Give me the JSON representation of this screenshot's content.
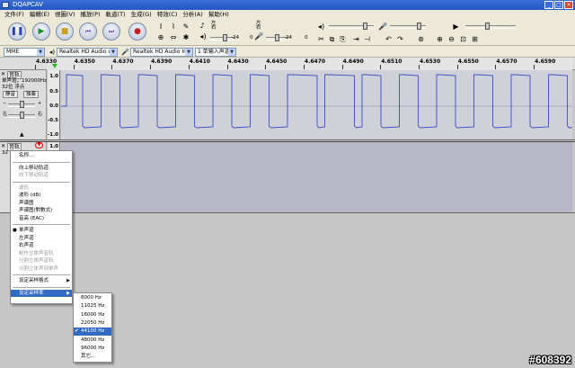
{
  "window": {
    "title": "DQAPCAV"
  },
  "menu": [
    "文件(F)",
    "編輯(E)",
    "視圖(V)",
    "播放(P)",
    "軌道(T)",
    "生成(G)",
    "特效(C)",
    "分析(A)",
    "幫助(H)"
  ],
  "transport": {
    "pause_icon": "pause-icon",
    "play_icon": "play-icon",
    "stop_icon": "stop-icon",
    "skip_start_icon": "skip-start-icon",
    "skip_end_icon": "skip-end-icon",
    "record_icon": "record-icon"
  },
  "tools": [
    "I",
    "✎",
    "⊕",
    "⇔",
    "✱"
  ],
  "meters": {
    "out_lr": "左\n右",
    "in_lr": "左\n右",
    "scale_out": "-24      0",
    "scale_in": "-24      0"
  },
  "colors": {
    "accent": "#316ac5",
    "wave": "#3a4fc4",
    "selection": "#b7b7c7"
  },
  "device": {
    "host": "MME",
    "output": "Realtek HD Audio ou",
    "input": "Realtek HD Audio Inp",
    "channels": "1 单输入声道"
  },
  "ruler": {
    "labels": [
      "4.6330",
      "4.6350",
      "4.6370",
      "4.6390",
      "4.6410",
      "4.6430",
      "4.6450",
      "4.6470",
      "4.6490",
      "4.6510",
      "4.6530",
      "4.6550",
      "4.6570",
      "4.6590"
    ]
  },
  "track1": {
    "name": "音轨",
    "info1": "单声道，192000Hz",
    "info2": "32位 浮点",
    "mute": "静音",
    "solo": "独奏",
    "y_top": "1.0",
    "y_mid1": "0.5",
    "y_zero": "0.0",
    "y_mid2": "-0.5",
    "y_bottom": "-1.0",
    "slider_l": "左",
    "slider_r": "右"
  },
  "track2": {
    "name": "音轨",
    "y_top": "1.0",
    "info": "32"
  },
  "context_menu": {
    "items": [
      {
        "label": "名称...",
        "state": "normal"
      },
      {
        "label": "向上移动轨道",
        "state": "normal"
      },
      {
        "label": "向下移动轨道",
        "state": "disabled"
      },
      {
        "label": "波形",
        "state": "disabled"
      },
      {
        "label": "波形 (dB)",
        "state": "normal"
      },
      {
        "label": "声谱图",
        "state": "normal"
      },
      {
        "label": "声谱图(對數式)",
        "state": "normal"
      },
      {
        "label": "音高 (EAC)",
        "state": "normal"
      },
      {
        "label": "单声道",
        "state": "checked"
      },
      {
        "label": "左声道",
        "state": "normal"
      },
      {
        "label": "右声道",
        "state": "normal"
      },
      {
        "label": "制作立体声音轨",
        "state": "disabled"
      },
      {
        "label": "分割立体声音轨",
        "state": "disabled"
      },
      {
        "label": "分割立体声到单声",
        "state": "disabled"
      },
      {
        "label": "设定采样格式",
        "state": "submenu"
      },
      {
        "label": "设定采样率",
        "state": "highlight"
      }
    ]
  },
  "rate_submenu": {
    "items": [
      {
        "label": "8000 Hz",
        "state": "normal"
      },
      {
        "label": "11025 Hz",
        "state": "normal"
      },
      {
        "label": "16000 Hz",
        "state": "normal"
      },
      {
        "label": "22050 Hz",
        "state": "normal"
      },
      {
        "label": "44100 Hz",
        "state": "highlight"
      },
      {
        "label": "48000 Hz",
        "state": "normal"
      },
      {
        "label": "96000 Hz",
        "state": "normal"
      },
      {
        "label": "其它...",
        "state": "normal"
      }
    ]
  },
  "watermark": "#608392"
}
